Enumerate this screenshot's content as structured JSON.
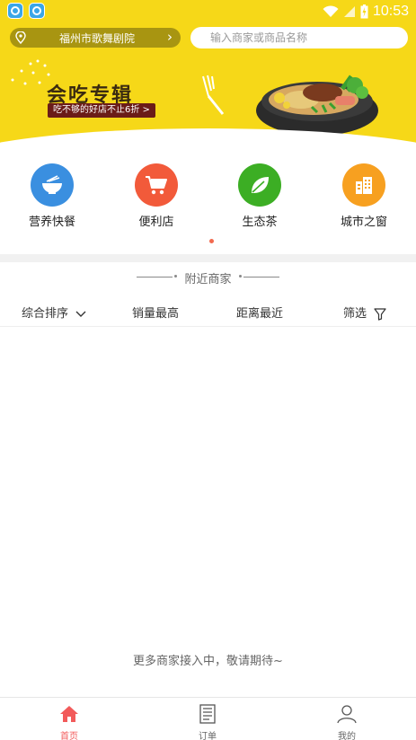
{
  "status_bar": {
    "time": "10:53",
    "icons": [
      "app-badge-icon",
      "app-badge-icon",
      "wifi-icon",
      "signal-icon",
      "battery-charging-icon"
    ]
  },
  "header": {
    "location": "福州市歌舞剧院",
    "search_placeholder": "输入商家或商品名称"
  },
  "banner": {
    "title": "会吃专辑",
    "subtitle": "吃不够的好店不止6折 >"
  },
  "categories": [
    {
      "label": "营养快餐",
      "icon": "bowl-icon",
      "color": "#3a8fe0"
    },
    {
      "label": "便利店",
      "icon": "shopping-cart-icon",
      "color": "#f25a3a"
    },
    {
      "label": "生态茶",
      "icon": "leaf-icon",
      "color": "#3cae24"
    },
    {
      "label": "城市之窗",
      "icon": "buildings-icon",
      "color": "#f7a020"
    }
  ],
  "nearby": {
    "title": "附近商家"
  },
  "sort": {
    "items": [
      {
        "label": "综合排序",
        "icon": "chevron-down-icon"
      },
      {
        "label": "销量最高"
      },
      {
        "label": "距离最近"
      },
      {
        "label": "筛选",
        "icon": "filter-icon"
      }
    ]
  },
  "empty_message": "更多商家接入中，敬请期待~",
  "tabs": [
    {
      "label": "首页",
      "icon": "home-icon",
      "active": true
    },
    {
      "label": "订单",
      "icon": "order-icon",
      "active": false
    },
    {
      "label": "我的",
      "icon": "user-icon",
      "active": false
    }
  ],
  "colors": {
    "brand_yellow": "#f6d818",
    "accent_red": "#f25a5a"
  }
}
